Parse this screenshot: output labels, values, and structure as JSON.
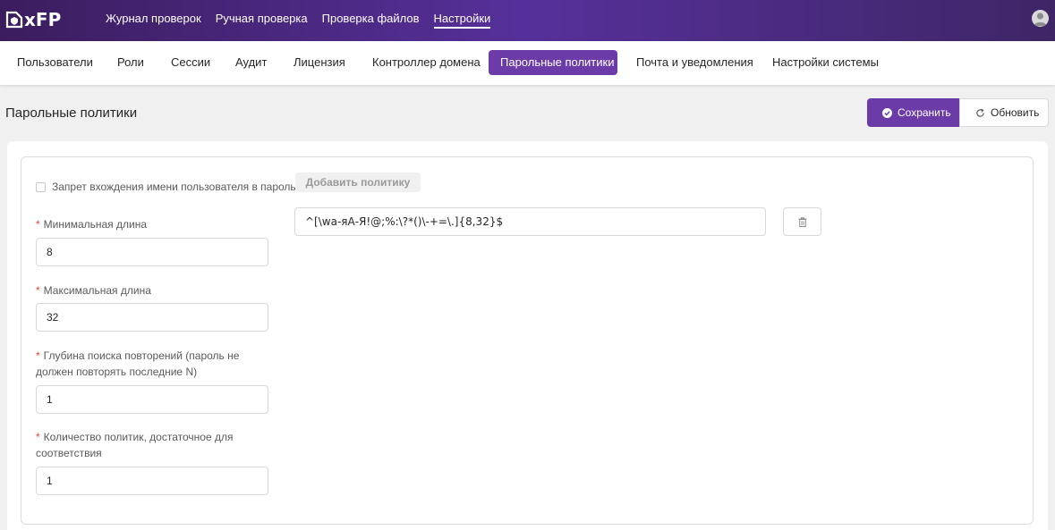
{
  "app": {
    "logo_text": "xFP"
  },
  "topnav": {
    "items": [
      {
        "label": "Журнал проверок"
      },
      {
        "label": "Ручная проверка"
      },
      {
        "label": "Проверка файлов"
      },
      {
        "label": "Настройки",
        "active": true
      }
    ]
  },
  "subnav": {
    "items": [
      {
        "label": "Пользователи"
      },
      {
        "label": "Роли"
      },
      {
        "label": "Сессии"
      },
      {
        "label": "Аудит"
      },
      {
        "label": "Лицензия"
      },
      {
        "label": "Контроллер домена"
      },
      {
        "label": "Парольные политики",
        "active": true
      },
      {
        "label": "Почта и уведомления"
      },
      {
        "label": "Настройки системы"
      }
    ]
  },
  "page": {
    "title": "Парольные политики",
    "save_label": "Сохранить",
    "refresh_label": "Обновить"
  },
  "form": {
    "username_ban_label": "Запрет вхождения имени пользователя в пароль",
    "username_ban_checked": false,
    "add_policy_label": "Добавить политику",
    "required_mark": "*",
    "min_length_label": "Минимальная длина",
    "min_length_value": "8",
    "max_length_label": "Максимальная длина",
    "max_length_value": "32",
    "history_depth_label": "Глубина поиска повторений (пароль не должен повторять последние N)",
    "history_depth_value": "1",
    "policies_count_label": "Количество политик, достаточное для соответствия",
    "policies_count_value": "1"
  },
  "policies": [
    {
      "value": "^[\\wа-яА-Я!@;%:\\?*()\\-+=\\.]{8,32}$"
    }
  ],
  "colors": {
    "accent": "#6b3ba8",
    "topbar_start": "#3b1d5e",
    "topbar_end": "#56309a",
    "required": "#e8423a"
  }
}
